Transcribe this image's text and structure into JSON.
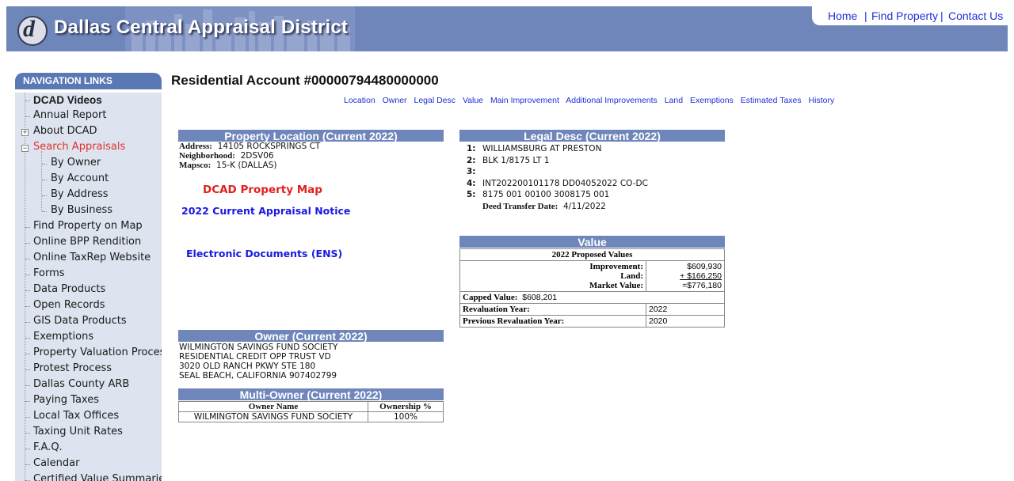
{
  "header": {
    "title": "Dallas Central Appraisal District",
    "logo_glyph": "d",
    "links": [
      "Home",
      "Find Property",
      "Contact Us"
    ]
  },
  "nav": {
    "header": "NAVIGATION LINKS",
    "items": [
      {
        "label": "DCAD Videos"
      },
      {
        "label": "Annual Report"
      },
      {
        "label": "About DCAD"
      },
      {
        "label": "Search Appraisals"
      },
      {
        "label": "By Owner"
      },
      {
        "label": "By Account"
      },
      {
        "label": "By Address"
      },
      {
        "label": "By Business"
      },
      {
        "label": "Find Property on Map"
      },
      {
        "label": "Online BPP Rendition"
      },
      {
        "label": "Online TaxRep Website"
      },
      {
        "label": "Forms"
      },
      {
        "label": "Data Products"
      },
      {
        "label": "Open Records"
      },
      {
        "label": "GIS Data Products"
      },
      {
        "label": "Exemptions"
      },
      {
        "label": "Property Valuation Process"
      },
      {
        "label": "Protest Process"
      },
      {
        "label": "Dallas County ARB"
      },
      {
        "label": "Paying Taxes"
      },
      {
        "label": "Local Tax Offices"
      },
      {
        "label": "Taxing Unit Rates"
      },
      {
        "label": "F.A.Q."
      },
      {
        "label": "Calendar"
      },
      {
        "label": "Certified Value Summaries"
      }
    ]
  },
  "main": {
    "title": "Residential Account #00000794480000000",
    "sub_links": [
      "Location",
      "Owner",
      "Legal Desc",
      "Value",
      "Main Improvement",
      "Additional Improvements",
      "Land",
      "Exemptions",
      "Estimated Taxes",
      "History"
    ],
    "property_location": {
      "header": "Property Location (Current 2022)",
      "address_label": "Address:",
      "address": "14105  ROCKSPRINGS CT",
      "neighborhood_label": "Neighborhood:",
      "neighborhood": "2DSV06",
      "mapsco_label": "Mapsco:",
      "mapsco": "15-K (DALLAS)"
    },
    "dcad_map": "DCAD Property Map",
    "appraisal_notice": "2022 Current Appraisal Notice",
    "ens": "Electronic Documents (ENS)",
    "legal_desc": {
      "header": "Legal Desc (Current 2022)",
      "lines": [
        {
          "num": "1:",
          "text": "WILLIAMSBURG AT PRESTON"
        },
        {
          "num": "2:",
          "text": "BLK 1/8175 LT 1"
        },
        {
          "num": "3:",
          "text": ""
        },
        {
          "num": "4:",
          "text": "INT202200101178 DD04052022 CO-DC"
        },
        {
          "num": "5:",
          "text": "8175 001 00100 3008175 001"
        }
      ],
      "deed_label": "Deed Transfer Date:",
      "deed_date": "4/11/2022"
    },
    "value": {
      "header": "Value",
      "proposed_header": "2022 Proposed Values",
      "improvement_label": "Improvement:",
      "improvement": "$609,930",
      "land_label": "Land:",
      "land": "+ $166,250",
      "market_label": "Market Value:",
      "market": "=$776,180",
      "capped_label": "Capped Value:",
      "capped": "$608,201",
      "reval_label": "Revaluation Year:",
      "reval": "2022",
      "prev_reval_label": "Previous Revaluation Year:",
      "prev_reval": "2020"
    },
    "owner": {
      "header": "Owner (Current 2022)",
      "lines": [
        "WILMINGTON SAVINGS FUND SOCIETY",
        "RESIDENTIAL CREDIT OPP TRUST VD",
        "3020 OLD RANCH PKWY STE 180",
        "SEAL BEACH, CALIFORNIA 907402799"
      ]
    },
    "multi_owner": {
      "header": "Multi-Owner (Current 2022)",
      "col_owner": "Owner Name",
      "col_pct": "Ownership %",
      "rows": [
        {
          "name": "WILMINGTON SAVINGS FUND SOCIETY",
          "pct": "100%"
        }
      ]
    }
  }
}
